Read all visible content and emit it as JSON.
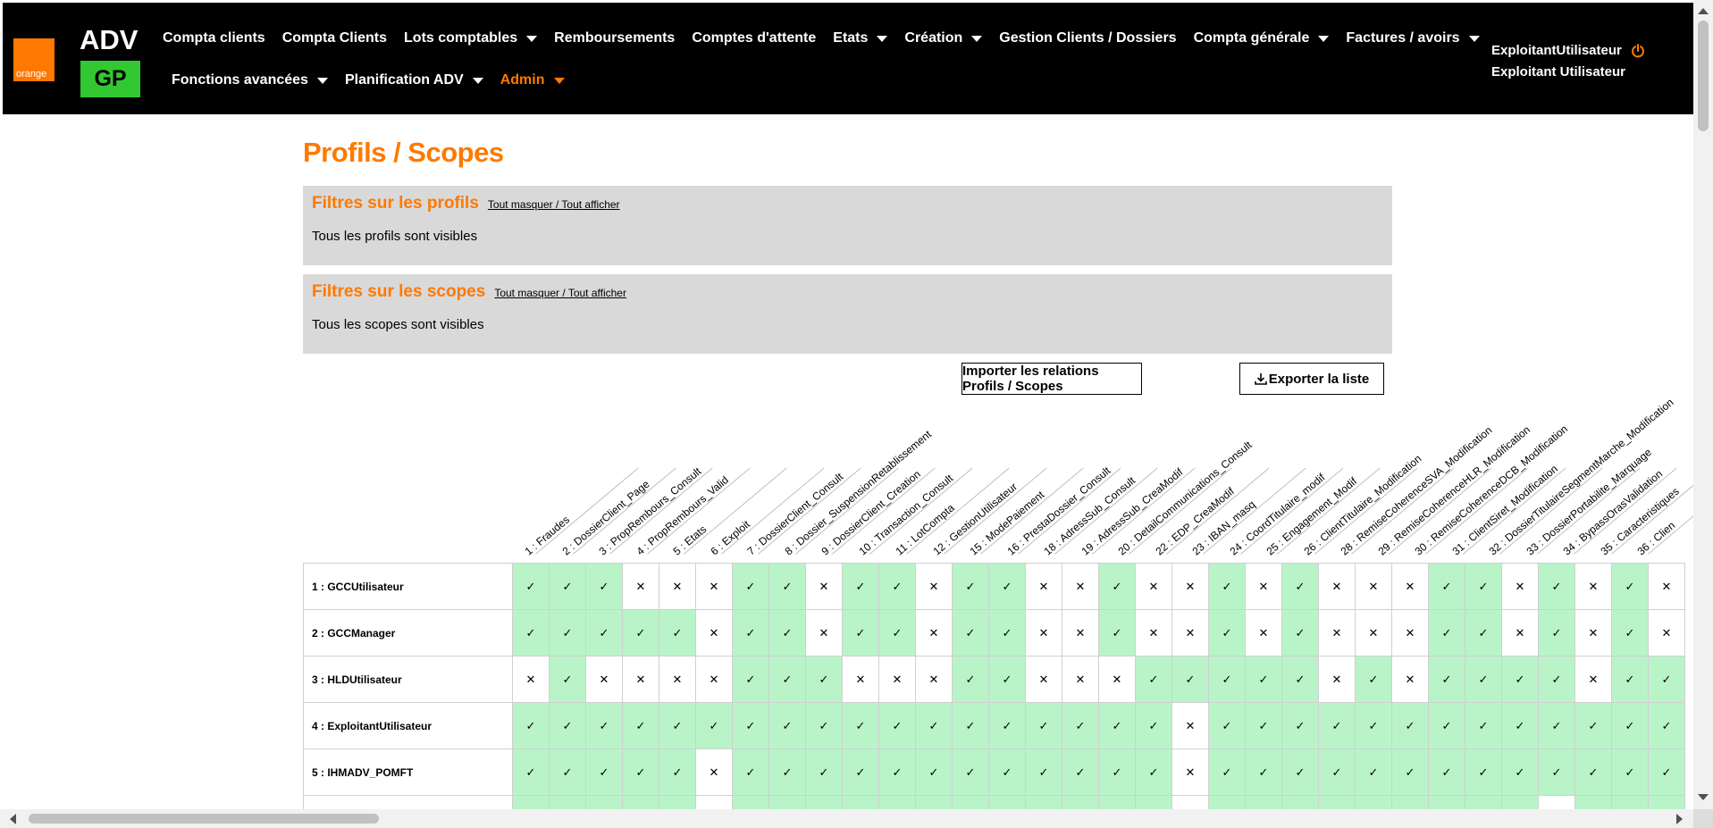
{
  "header": {
    "logo_text": "orange",
    "app_name": "ADV",
    "app_badge": "GP",
    "nav_row1": [
      {
        "label": "Compta clients",
        "dropdown": false,
        "active": false
      },
      {
        "label": "Compta Clients",
        "dropdown": false,
        "active": false
      },
      {
        "label": "Lots comptables",
        "dropdown": true,
        "active": false
      },
      {
        "label": "Remboursements",
        "dropdown": false,
        "active": false
      },
      {
        "label": "Comptes d'attente",
        "dropdown": false,
        "active": false
      },
      {
        "label": "Etats",
        "dropdown": true,
        "active": false
      },
      {
        "label": "Création",
        "dropdown": true,
        "active": false
      },
      {
        "label": "Gestion Clients / Dossiers",
        "dropdown": false,
        "active": false
      },
      {
        "label": "Compta générale",
        "dropdown": true,
        "active": false
      },
      {
        "label": "Factures / avoirs",
        "dropdown": true,
        "active": false
      }
    ],
    "nav_row2": [
      {
        "label": "Fonctions avancées",
        "dropdown": true,
        "active": false
      },
      {
        "label": "Planification ADV",
        "dropdown": true,
        "active": false
      },
      {
        "label": "Admin",
        "dropdown": true,
        "active": true
      }
    ],
    "user_login": "ExploitantUtilisateur",
    "user_name": "Exploitant Utilisateur"
  },
  "colors": {
    "accent": "#ff7900",
    "badge": "#32c832",
    "granted": "#b8f4c8",
    "header_bg": "#000000"
  },
  "page": {
    "title": "Profils / Scopes",
    "profiles_filter": {
      "title": "Filtres sur les profils",
      "toggle_link": "Tout masquer / Tout afficher",
      "status": "Tous les profils sont visibles"
    },
    "scopes_filter": {
      "title": "Filtres sur les scopes",
      "toggle_link": "Tout masquer / Tout afficher",
      "status": "Tous les scopes sont visibles"
    },
    "import_button": "Importer les relations Profils / Scopes",
    "export_button": "Exporter la liste"
  },
  "matrix": {
    "granted_symbol": "✓",
    "denied_symbol": "✕",
    "scopes": [
      "1 : Fraudes",
      "2 : DossierClient_Page",
      "3 : PropRembours_Consult",
      "4 : PropRembours_Valid",
      "5 : Etats",
      "6 : Exploit",
      "7 : DossierClient_Consult",
      "8 : Dossier_SuspensionRetablissement",
      "9 : DossierClient_Creation",
      "10 : Transaction_Consult",
      "11 : LotCompta",
      "12 : GestionUtilisateur",
      "15 : ModePaiement",
      "16 : PrestaDossier_Consult",
      "18 : AdressSub_Consult",
      "19 : AdressSub_CreaModif",
      "20 : DetailCommunications_Consult",
      "22 : EDP_CreaModif",
      "23 : IBAN_masq",
      "24 : CoordTitulaire_modif",
      "25 : Engagement_Modif",
      "26 : ClientTitulaire_Modification",
      "28 : RemiseCoherenceSVA_Modification",
      "29 : RemiseCoherenceHLR_Modification",
      "30 : RemiseCoherenceDCB_Modification",
      "31 : ClientSiret_Modification",
      "32 : DossierTitulaireSegmentMarche_Modification",
      "33 : DossierPortabilite_Marquage",
      "34 : BypassOrasValidation",
      "35 : Caracteristiques",
      "36 : Clien"
    ],
    "profiles": [
      {
        "label": "1 : GCCUtilisateur",
        "access": [
          1,
          1,
          1,
          0,
          0,
          0,
          1,
          1,
          0,
          1,
          1,
          0,
          1,
          1,
          0,
          0,
          1,
          0,
          0,
          1,
          0,
          1,
          0,
          0,
          0,
          1,
          1,
          0,
          1,
          0,
          1,
          0
        ]
      },
      {
        "label": "2 : GCCManager",
        "access": [
          1,
          1,
          1,
          1,
          1,
          0,
          1,
          1,
          0,
          1,
          1,
          0,
          1,
          1,
          0,
          0,
          1,
          0,
          0,
          1,
          0,
          1,
          0,
          0,
          0,
          1,
          1,
          0,
          1,
          0,
          1,
          0
        ]
      },
      {
        "label": "3 : HLDUtilisateur",
        "access": [
          0,
          1,
          0,
          0,
          0,
          0,
          1,
          1,
          1,
          0,
          0,
          0,
          1,
          1,
          0,
          0,
          0,
          1,
          1,
          1,
          1,
          1,
          0,
          1,
          0,
          1,
          1,
          1,
          1,
          0,
          1,
          1
        ]
      },
      {
        "label": "4 : ExploitantUtilisateur",
        "access": [
          1,
          1,
          1,
          1,
          1,
          1,
          1,
          1,
          1,
          1,
          1,
          1,
          1,
          1,
          1,
          1,
          1,
          1,
          0,
          1,
          1,
          1,
          1,
          1,
          1,
          1,
          1,
          1,
          1,
          1,
          1,
          1
        ]
      },
      {
        "label": "5 : IHMADV_POMFT",
        "access": [
          1,
          1,
          1,
          1,
          1,
          0,
          1,
          1,
          1,
          1,
          1,
          1,
          1,
          1,
          1,
          1,
          1,
          1,
          0,
          1,
          1,
          1,
          1,
          1,
          1,
          1,
          1,
          1,
          1,
          1,
          1,
          1
        ]
      },
      {
        "label": "",
        "access": [
          1,
          1,
          1,
          1,
          1,
          0,
          1,
          1,
          1,
          1,
          1,
          1,
          1,
          1,
          1,
          1,
          1,
          1,
          0,
          1,
          1,
          1,
          1,
          1,
          1,
          1,
          1,
          1,
          0,
          1,
          1,
          1
        ]
      }
    ]
  }
}
